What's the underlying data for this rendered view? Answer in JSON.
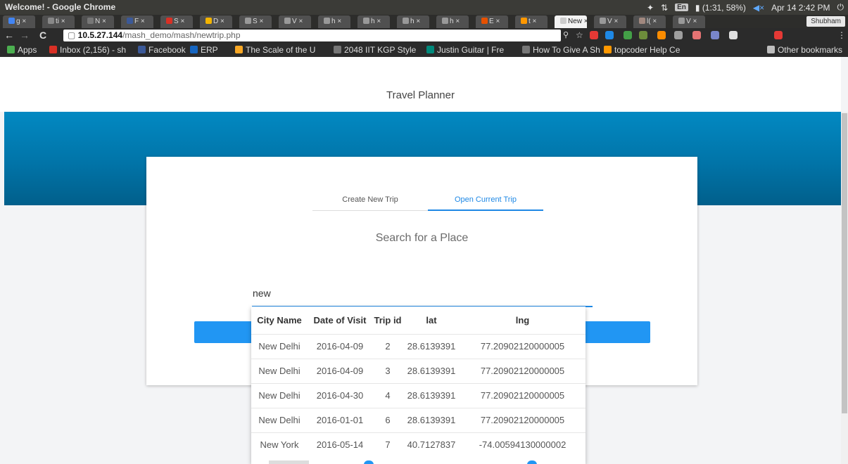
{
  "window": {
    "title": "Welcome! - Google Chrome",
    "tray_status": "(1:31, 58%)",
    "tray_lang": "En",
    "tray_datetime": "Apr 14  2:42 PM"
  },
  "tabs": [
    {
      "label": "g ×",
      "color": "#4285f4"
    },
    {
      "label": "ti ×",
      "color": "#888888"
    },
    {
      "label": "N ×",
      "color": "#777777"
    },
    {
      "label": "F ×",
      "color": "#3b5998"
    },
    {
      "label": "S ×",
      "color": "#d93025"
    },
    {
      "label": "D ×",
      "color": "#f4b400"
    },
    {
      "label": "S ×",
      "color": "#999999"
    },
    {
      "label": "V ×",
      "color": "#999999"
    },
    {
      "label": "h ×",
      "color": "#999999"
    },
    {
      "label": "h ×",
      "color": "#999999"
    },
    {
      "label": "h ×",
      "color": "#999999"
    },
    {
      "label": "h ×",
      "color": "#999999"
    },
    {
      "label": "E ×",
      "color": "#e65100"
    },
    {
      "label": "t ×",
      "color": "#ff9800"
    },
    {
      "label": "New ×",
      "color": "#cccccc",
      "active": true
    },
    {
      "label": "V ×",
      "color": "#999999"
    },
    {
      "label": "l( ×",
      "color": "#a1887f"
    },
    {
      "label": "V ×",
      "color": "#999999"
    }
  ],
  "profile_name": "Shubham",
  "address": {
    "host": "10.5.27.144",
    "path": "/mash_demo/mash/newtrip.php"
  },
  "bookmarks": [
    {
      "label": "Apps",
      "color": "#4caf50"
    },
    {
      "label": "Inbox (2,156) - sh",
      "color": "#d93025"
    },
    {
      "label": "Facebook",
      "color": "#3b5998"
    },
    {
      "label": "ERP",
      "color": "#1565c0"
    },
    {
      "label": "The Scale of the U",
      "color": "#f9a825"
    },
    {
      "label": "2048 IIT KGP Style",
      "color": "#777777"
    },
    {
      "label": "Justin Guitar | Fre",
      "color": "#00897b"
    },
    {
      "label": "How To Give A Sh",
      "color": "#777777"
    },
    {
      "label": "topcoder Help Ce",
      "color": "#ff9800"
    }
  ],
  "bookmarks_overflow": "»",
  "other_bookmarks": "Other bookmarks",
  "page": {
    "title": "Travel Planner",
    "tabs": {
      "create": "Create New Trip",
      "open": "Open Current Trip"
    },
    "search_heading": "Search for a Place",
    "search_value": "new"
  },
  "autocomplete": {
    "columns": [
      "City Name",
      "Date of Visit",
      "Trip id",
      "lat",
      "lng"
    ],
    "rows": [
      [
        "New Delhi",
        "2016-04-09",
        "2",
        "28.6139391",
        "77.20902120000005"
      ],
      [
        "New Delhi",
        "2016-04-09",
        "3",
        "28.6139391",
        "77.20902120000005"
      ],
      [
        "New Delhi",
        "2016-04-30",
        "4",
        "28.6139391",
        "77.20902120000005"
      ],
      [
        "New Delhi",
        "2016-01-01",
        "6",
        "28.6139391",
        "77.20902120000005"
      ],
      [
        "New York",
        "2016-05-14",
        "7",
        "40.7127837",
        "-74.00594130000002"
      ]
    ]
  },
  "colors": {
    "accent": "#1e88e5",
    "hero": "#0289c2",
    "button": "#2196f3"
  }
}
